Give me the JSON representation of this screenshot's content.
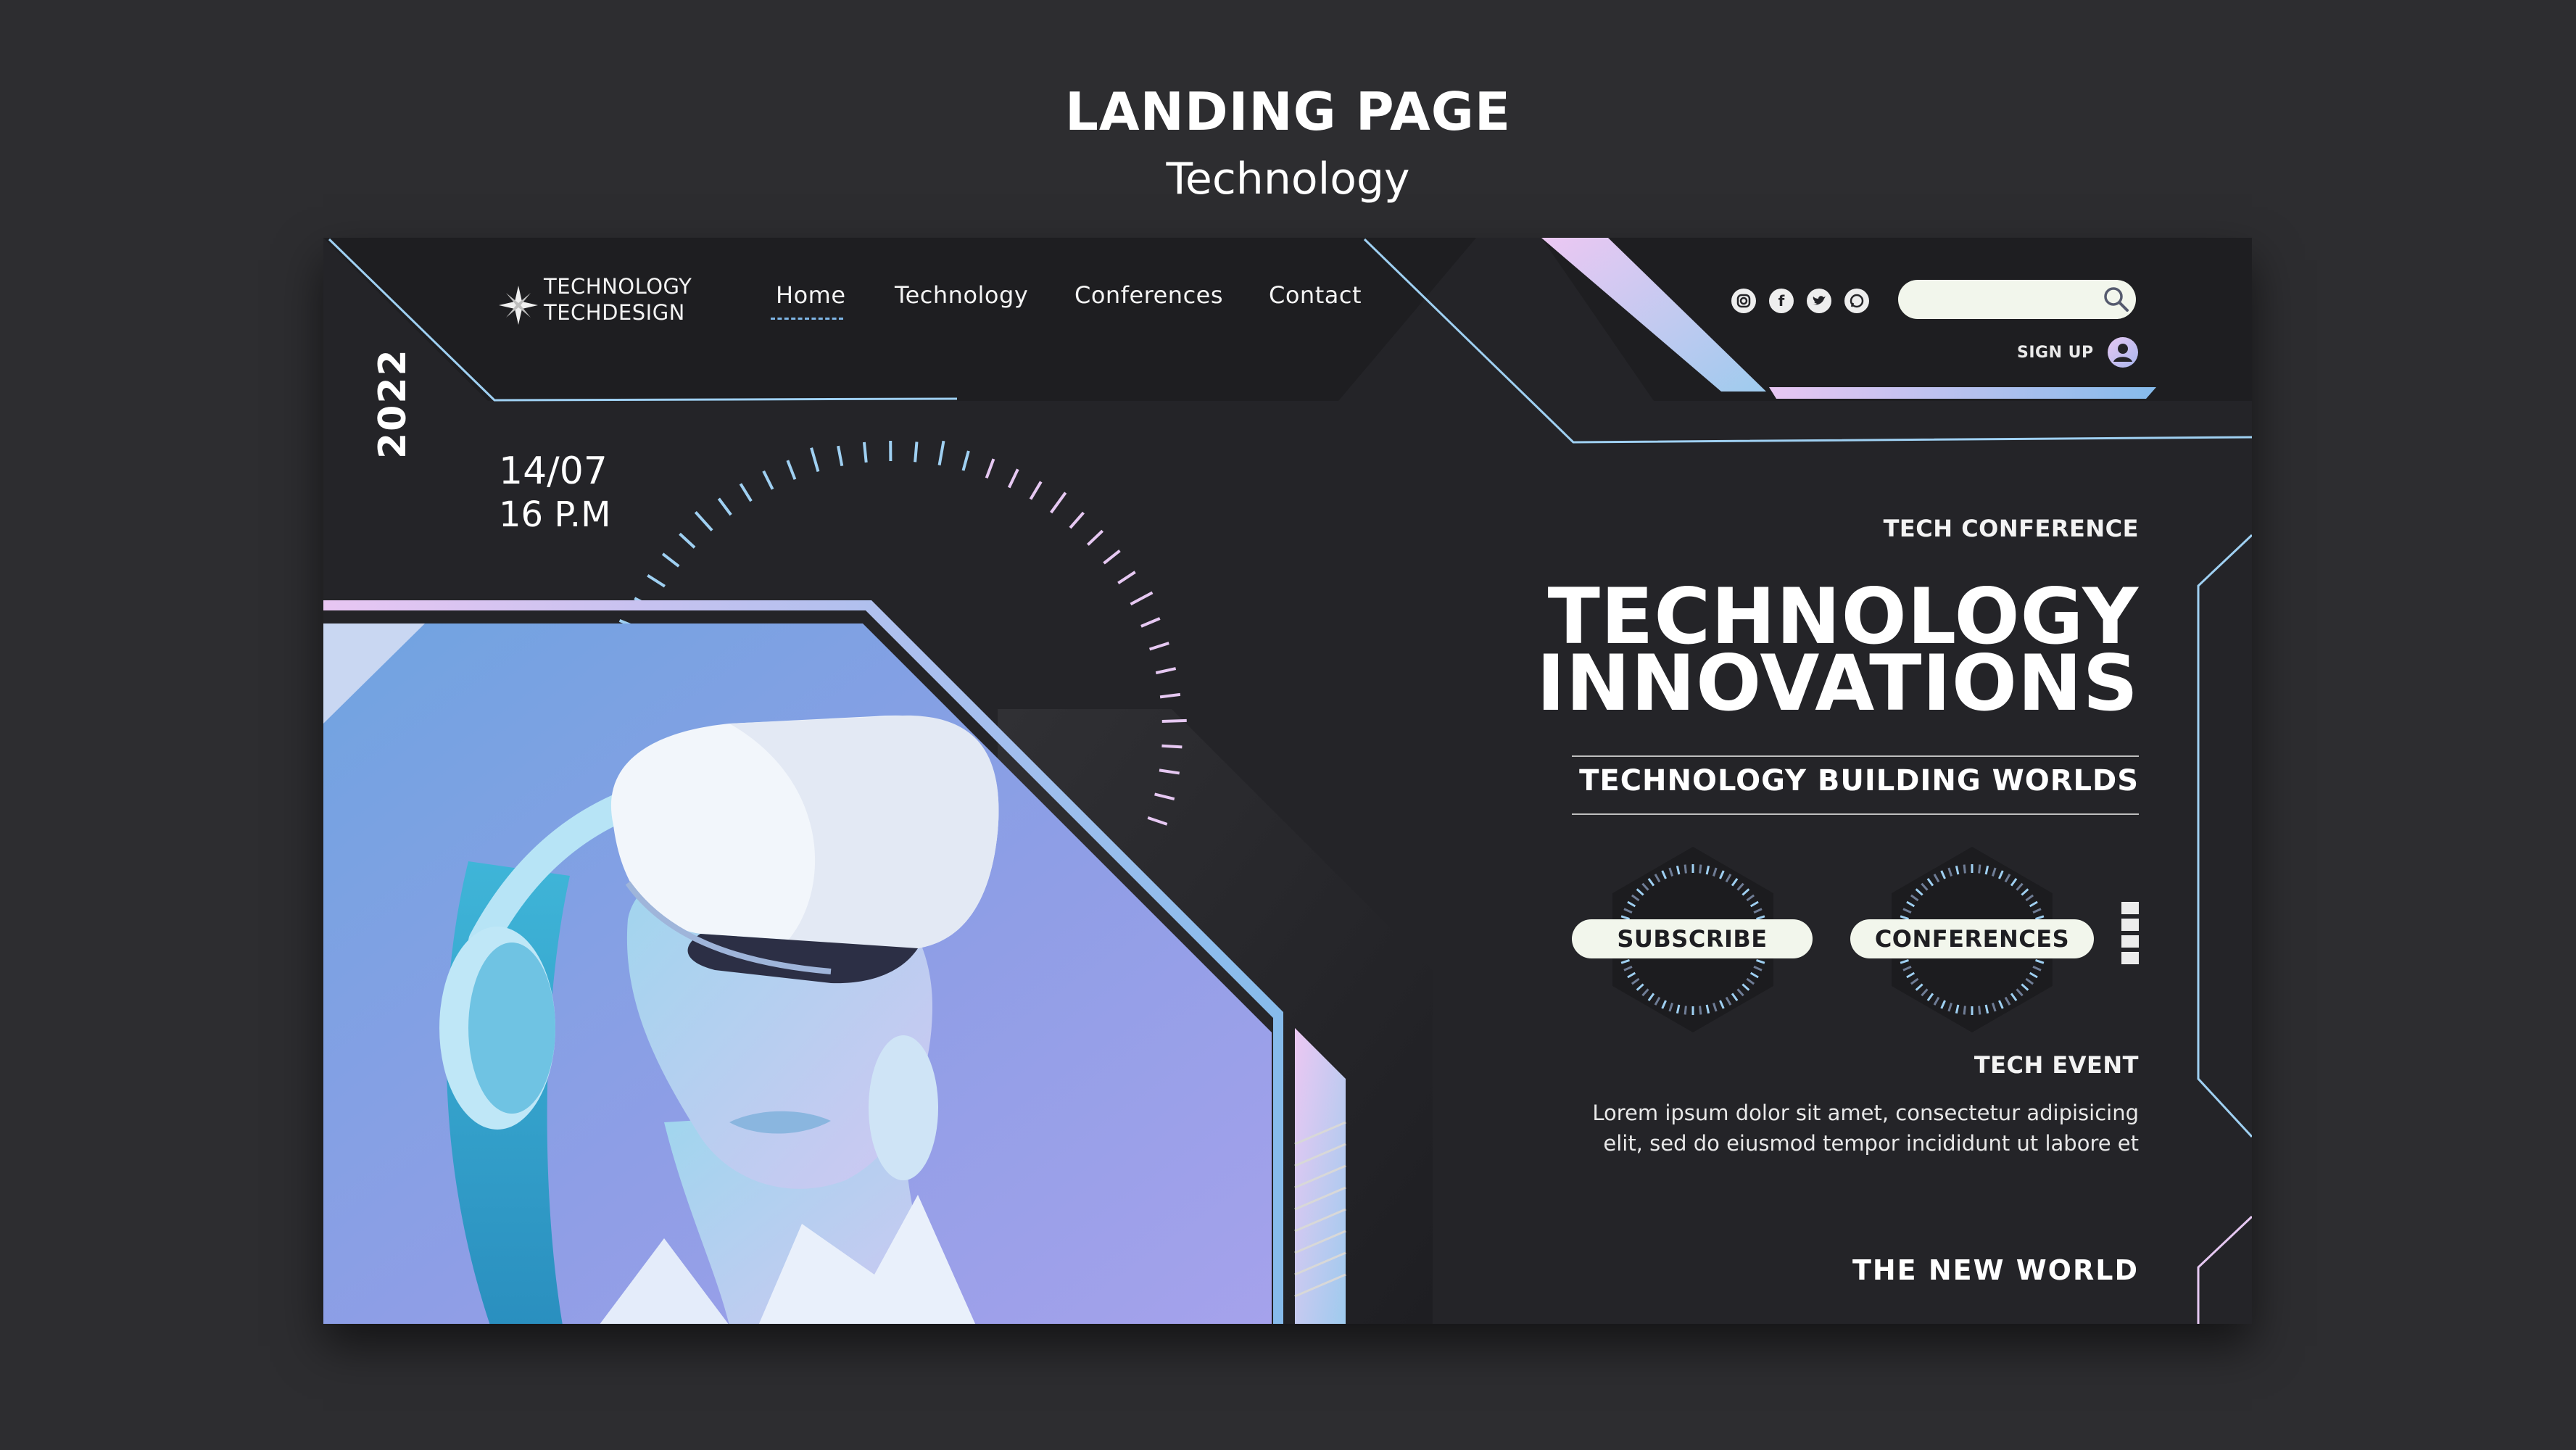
{
  "presentation": {
    "title": "LANDING PAGE",
    "subtitle": "Technology"
  },
  "brand": {
    "line1": "TECHNOLOGY",
    "line2": "TECHDESIGN",
    "icon": "star-burst-icon"
  },
  "nav": {
    "items": [
      {
        "label": "Home",
        "active": true
      },
      {
        "label": "Technology",
        "active": false
      },
      {
        "label": "Conferences",
        "active": false
      },
      {
        "label": "Contact",
        "active": false
      }
    ]
  },
  "social": [
    {
      "name": "instagram-icon"
    },
    {
      "name": "facebook-icon"
    },
    {
      "name": "twitter-icon"
    },
    {
      "name": "whatsapp-icon"
    }
  ],
  "search": {
    "value": "",
    "placeholder": "",
    "icon": "search-icon"
  },
  "account": {
    "signup_label": "SIGN UP",
    "icon": "user-icon"
  },
  "event": {
    "year": "2022",
    "date": "14/07",
    "time": "16 P.M"
  },
  "hero": {
    "eyebrow": "TECH CONFERENCE",
    "headline_line1": "TECHNOLOGY",
    "headline_line2": "INNOVATIONS",
    "tagline": "TECHNOLOGY BUILDING WORLDS"
  },
  "cta": {
    "subscribe_label": "SUBSCRIBE",
    "conferences_label": "CONFERENCES"
  },
  "details": {
    "label": "TECH EVENT",
    "description_line1": "Lorem ipsum dolor sit amet, consectetur adipisicing",
    "description_line2": "elit, sed do eiusmod tempor incididunt ut labore et",
    "footer_tagline": "THE NEW WORLD"
  },
  "colors": {
    "background": "#2d2d30",
    "card": "#242428",
    "accent_blue": "#7fb6e6",
    "accent_lilac": "#e6c8f2",
    "pill": "#f2f6ec"
  }
}
